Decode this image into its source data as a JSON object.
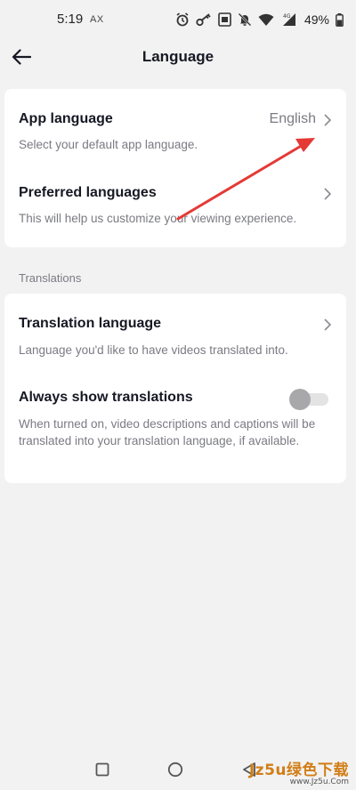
{
  "status_bar": {
    "time": "5:19",
    "carrier": "AX",
    "battery": "49%",
    "icons": [
      "alarm-icon",
      "key-icon",
      "nfc-icon",
      "mute-icon",
      "wifi-icon",
      "signal-4g-icon",
      "battery-icon"
    ]
  },
  "header": {
    "title": "Language",
    "back_icon": "arrow-left-icon"
  },
  "language_card": {
    "app_language": {
      "title": "App language",
      "value": "English",
      "subtitle": "Select your default app language."
    },
    "preferred_languages": {
      "title": "Preferred languages",
      "subtitle": "This will help us customize your viewing experience."
    }
  },
  "translations_section": {
    "label": "Translations",
    "translation_language": {
      "title": "Translation language",
      "subtitle": "Language you'd like to have videos translated into."
    },
    "always_show": {
      "title": "Always show translations",
      "subtitle": "When turned on, video descriptions and captions will be translated into your translation language, if available.",
      "enabled": false
    }
  },
  "nav_bar": {
    "buttons": [
      "square-icon",
      "circle-icon",
      "triangle-back-icon"
    ]
  },
  "watermark": {
    "main": "Jz5u绿色下载",
    "sub": "www.Jz5u.Com"
  },
  "colors": {
    "background": "#f2f2f2",
    "card": "#ffffff",
    "primary_text": "#161823",
    "secondary_text": "#7a7b82",
    "annotation_arrow": "#e53935"
  }
}
